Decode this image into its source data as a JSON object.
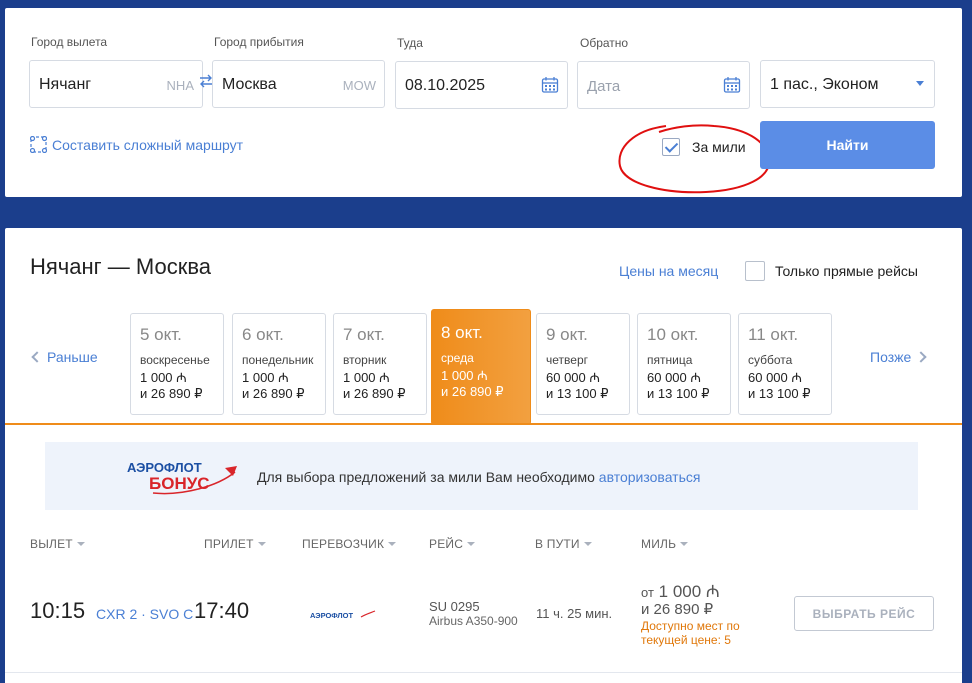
{
  "search": {
    "from_label": "Город вылета",
    "from_value": "Нячанг",
    "from_code": "NHA",
    "to_label": "Город прибытия",
    "to_value": "Москва",
    "to_code": "MOW",
    "depart_label": "Туда",
    "depart_value": "08.10.2025",
    "return_label": "Обратно",
    "return_placeholder": "Дата",
    "passengers_value": "1 пас., Эконом",
    "complex_route_link": "Составить сложный маршрут",
    "miles_checkbox_label": "За мили",
    "miles_checked": true,
    "find_button": "Найти"
  },
  "results": {
    "route_title": "Нячанг — Москва",
    "month_prices_link": "Цены на месяц",
    "direct_only_label": "Только прямые рейсы",
    "earlier": "Раньше",
    "later": "Позже",
    "days": [
      {
        "date": "5 окт.",
        "weekday": "воскресенье",
        "miles": "1 000 ₼",
        "money": "и 26 890 ₽"
      },
      {
        "date": "6 окт.",
        "weekday": "понедельник",
        "miles": "1 000 ₼",
        "money": "и 26 890 ₽"
      },
      {
        "date": "7 окт.",
        "weekday": "вторник",
        "miles": "1 000 ₼",
        "money": "и 26 890 ₽"
      },
      {
        "date": "8 окт.",
        "weekday": "среда",
        "miles": "1 000 ₼",
        "money": "и 26 890 ₽",
        "active": true
      },
      {
        "date": "9 окт.",
        "weekday": "четверг",
        "miles": "60 000 ₼",
        "money": "и 13 100 ₽"
      },
      {
        "date": "10 окт.",
        "weekday": "пятница",
        "miles": "60 000 ₼",
        "money": "и 13 100 ₽"
      },
      {
        "date": "11 окт.",
        "weekday": "суббота",
        "miles": "60 000 ₼",
        "money": "и 13 100 ₽"
      }
    ],
    "banner": {
      "logo_top": "АЭРОФЛОТ",
      "logo_bottom": "БОНУС",
      "text": "Для выбора предложений за мили Вам необходимо ",
      "link": "авторизоваться"
    },
    "columns": {
      "departure": "ВЫЛЕТ",
      "arrival": "ПРИЛЕТ",
      "carrier": "ПЕРЕВОЗЧИК",
      "flight": "РЕЙС",
      "duration": "В ПУТИ",
      "miles": "МИЛЬ"
    },
    "flight": {
      "dep_time": "10:15",
      "airports": "CXR 2 · SVO C",
      "arr_time": "17:40",
      "carrier_logo": "АЭРОФЛОТ",
      "flight_no": "SU 0295",
      "aircraft": "Airbus A350-900",
      "duration": "11 ч. 25 мин.",
      "miles_prefix": "от",
      "miles": "1 000 ₼",
      "money": "и 26 890 ₽",
      "availability": "Доступно мест по текущей цене: 5",
      "select_button": "ВЫБРАТЬ РЕЙС"
    }
  },
  "colors": {
    "background": "#1b3e8c",
    "accent": "#4a7fd4",
    "button": "#5b8de6",
    "active_day": "#ef8c1a"
  }
}
